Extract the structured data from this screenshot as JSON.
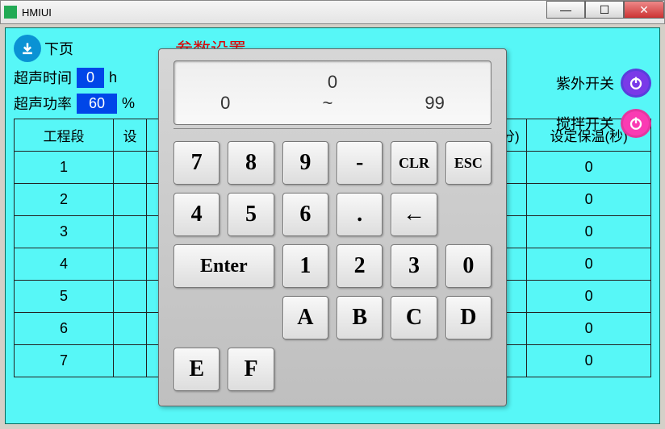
{
  "window": {
    "title": "HMIUI"
  },
  "nav": {
    "next_label": "下页",
    "page_title": "参数设置"
  },
  "params": {
    "ultrasonic_time_label": "超声时间",
    "ultrasonic_time_value": "0",
    "ultrasonic_time_unit": "h",
    "ultrasonic_power_label": "超声功率",
    "ultrasonic_power_value": "60",
    "ultrasonic_power_unit": "%"
  },
  "switches": {
    "uv_label": "紫外开关",
    "stir_label": "搅拌开关"
  },
  "table": {
    "headers": [
      "工程段",
      "设定",
      "",
      "",
      "(分)",
      "设定保温(秒)"
    ],
    "rows": [
      {
        "seg": "1",
        "val": "0"
      },
      {
        "seg": "2",
        "val": "0"
      },
      {
        "seg": "3",
        "val": "0"
      },
      {
        "seg": "4",
        "val": "0"
      },
      {
        "seg": "5",
        "val": "0"
      },
      {
        "seg": "6",
        "val": "0"
      },
      {
        "seg": "7",
        "val": "0"
      }
    ],
    "col0_header": "工程段",
    "col1_header": "设",
    "col4_header": "分)",
    "col5_header": "设定保温(秒)"
  },
  "keypad": {
    "current": "0",
    "min": "0",
    "sep": "~",
    "max": "99",
    "keys_row1": [
      "7",
      "8",
      "9",
      "-",
      "CLR",
      "ESC"
    ],
    "keys_row2": [
      "4",
      "5",
      "6",
      ".",
      "←"
    ],
    "enter": "Enter",
    "keys_row3": [
      "1",
      "2",
      "3",
      "0"
    ],
    "keys_row4": [
      "A",
      "B",
      "C",
      "D",
      "E",
      "F"
    ]
  }
}
